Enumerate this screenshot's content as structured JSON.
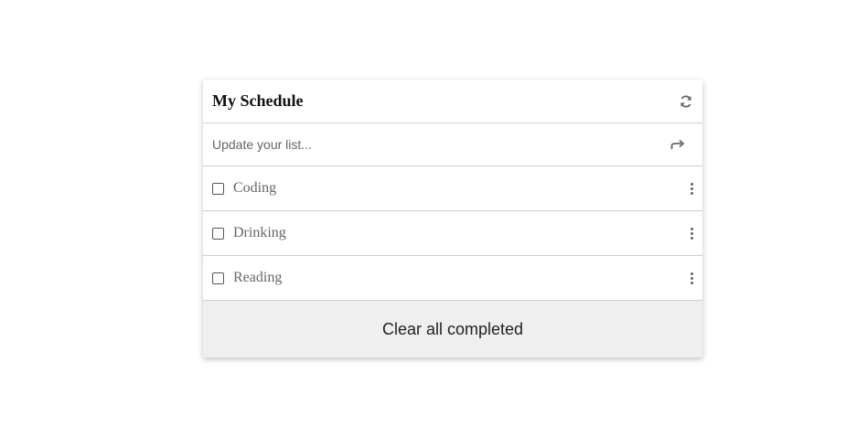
{
  "card": {
    "title": "My Schedule",
    "refresh_icon": "refresh-icon",
    "input": {
      "value": "",
      "placeholder": "Update your list...",
      "submit_icon": "forward-arrow-icon"
    },
    "items": [
      {
        "label": "Coding",
        "checked": false,
        "menu_icon": "kebab-menu-icon"
      },
      {
        "label": "Drinking",
        "checked": false,
        "menu_icon": "kebab-menu-icon"
      },
      {
        "label": "Reading",
        "checked": false,
        "menu_icon": "kebab-menu-icon"
      }
    ],
    "footer_label": "Clear all completed"
  },
  "colors": {
    "card_background": "#ffffff",
    "footer_background": "#efefef",
    "divider": "#cfcfcf",
    "muted_text": "#666666"
  }
}
